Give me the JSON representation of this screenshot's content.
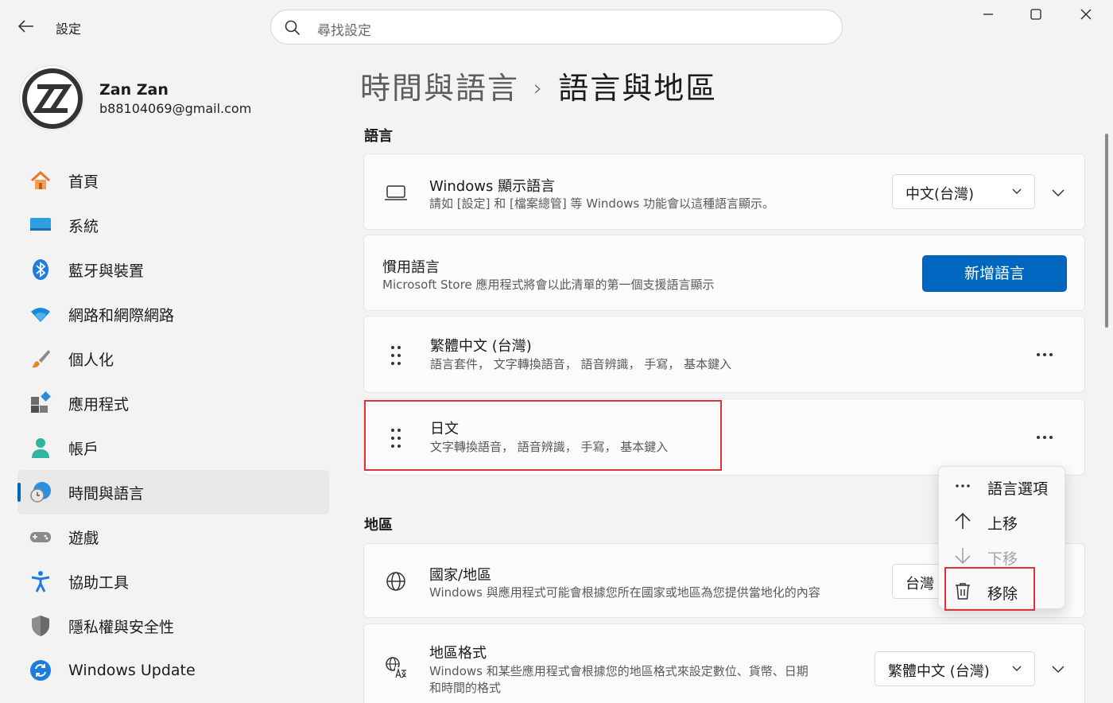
{
  "app": {
    "title": "設定"
  },
  "search": {
    "placeholder": "尋找設定"
  },
  "user": {
    "name": "Zan Zan",
    "email": "b88104069@gmail.com"
  },
  "nav": {
    "items": [
      {
        "label": "首頁",
        "icon": "home-icon"
      },
      {
        "label": "系統",
        "icon": "system-icon"
      },
      {
        "label": "藍牙與裝置",
        "icon": "bluetooth-icon"
      },
      {
        "label": "網路和網際網路",
        "icon": "wifi-icon"
      },
      {
        "label": "個人化",
        "icon": "brush-icon"
      },
      {
        "label": "應用程式",
        "icon": "apps-icon"
      },
      {
        "label": "帳戶",
        "icon": "account-icon"
      },
      {
        "label": "時間與語言",
        "icon": "time-language-icon",
        "active": true
      },
      {
        "label": "遊戲",
        "icon": "gamepad-icon"
      },
      {
        "label": "協助工具",
        "icon": "accessibility-icon"
      },
      {
        "label": "隱私權與安全性",
        "icon": "shield-icon"
      },
      {
        "label": "Windows Update",
        "icon": "update-icon"
      }
    ]
  },
  "breadcrumb": {
    "parent": "時間與語言",
    "separator": "›",
    "current": "語言與地區"
  },
  "language_section": {
    "heading": "語言",
    "display_language": {
      "title": "Windows 顯示語言",
      "description": "請如 [設定] 和 [檔案總管] 等 Windows 功能會以這種語言顯示。",
      "value": "中文(台灣)"
    },
    "preferred": {
      "title": "慣用語言",
      "description": "Microsoft Store 應用程式將會以此清單的第一個支援語言顯示",
      "add_button": "新增語言"
    },
    "languages": [
      {
        "name": "繁體中文 (台灣)",
        "features": "語言套件， 文字轉換語音， 語音辨識， 手寫， 基本鍵入"
      },
      {
        "name": "日文",
        "features": "文字轉換語音， 語音辨識， 手寫， 基本鍵入"
      }
    ]
  },
  "context_menu": {
    "items": [
      {
        "label": "語言選項",
        "icon": "more-icon",
        "enabled": true
      },
      {
        "label": "上移",
        "icon": "arrow-up-icon",
        "enabled": true
      },
      {
        "label": "下移",
        "icon": "arrow-down-icon",
        "enabled": false
      },
      {
        "label": "移除",
        "icon": "trash-icon",
        "enabled": true
      }
    ]
  },
  "region_section": {
    "heading": "地區",
    "country": {
      "title": "國家/地區",
      "description": "Windows 與應用程式可能會根據您所在國家或地區為您提供當地化的內容",
      "value": "台灣"
    },
    "format": {
      "title": "地區格式",
      "description_line1": "Windows 和某些應用程式會根據您的地區格式來設定數位、貨幣、日期",
      "description_line2": "和時間的格式",
      "value": "繁體中文 (台灣)"
    }
  },
  "colors": {
    "accent": "#0067c0",
    "highlight_box": "#d9343a",
    "background": "#f3f3f3"
  }
}
